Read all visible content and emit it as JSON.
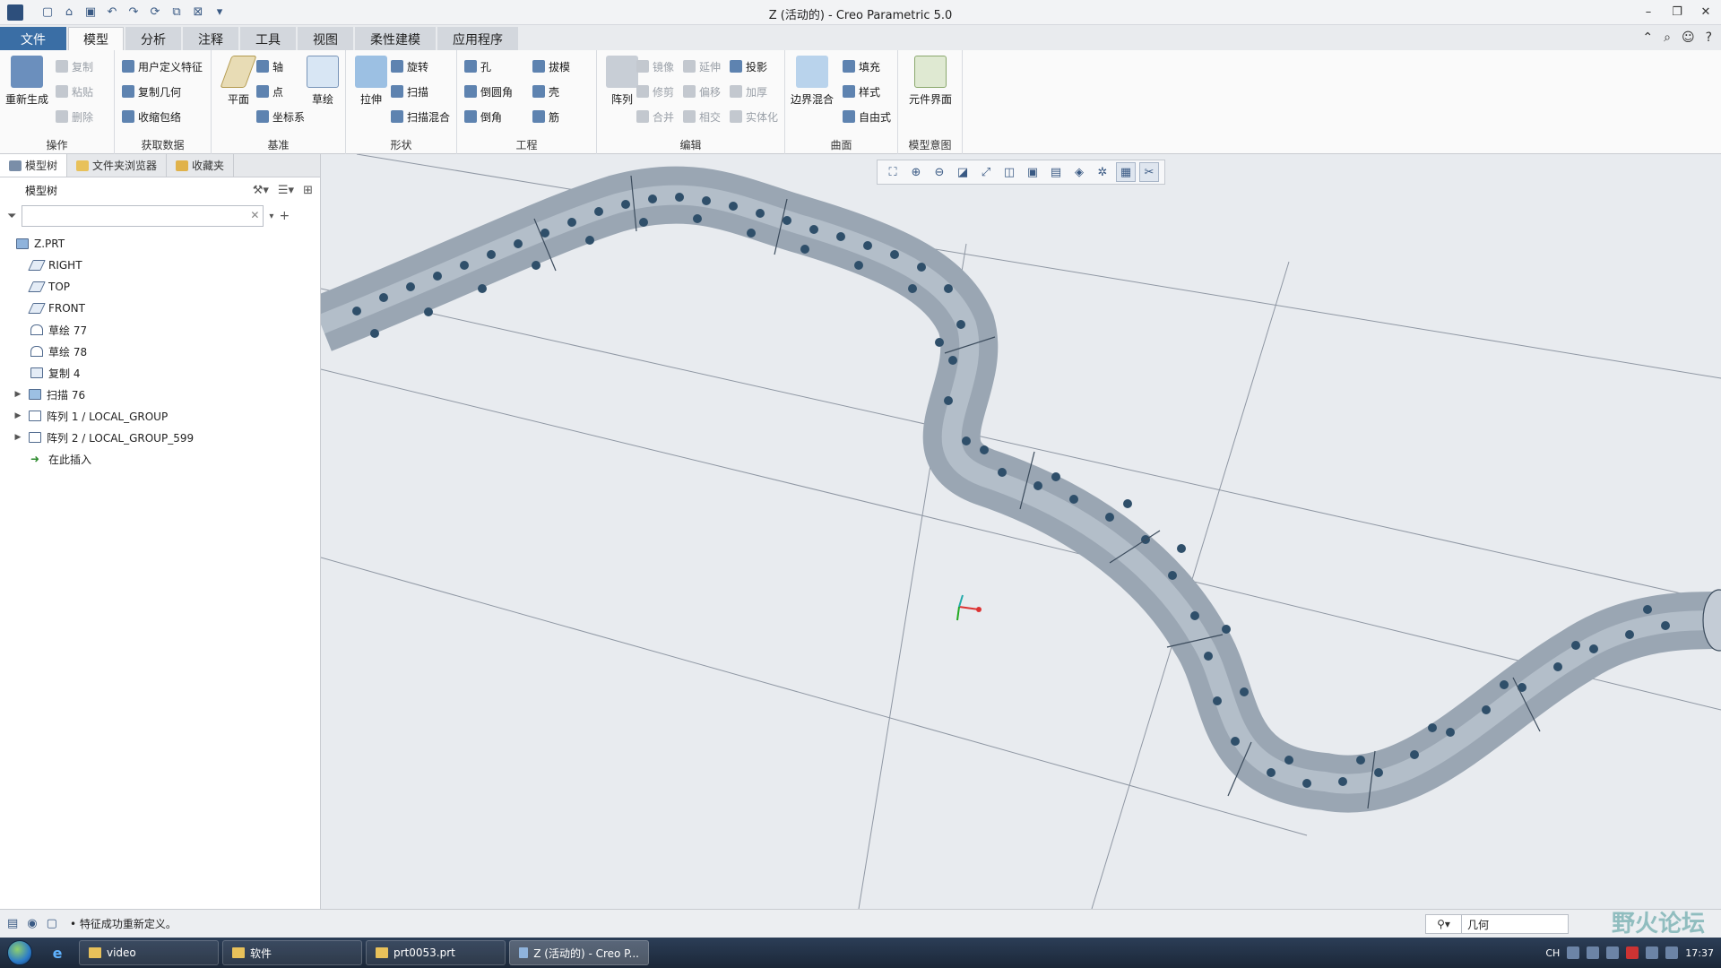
{
  "window": {
    "title": "Z (活动的) - Creo Parametric 5.0"
  },
  "ribbon_tabs": [
    {
      "label": "文件"
    },
    {
      "label": "模型"
    },
    {
      "label": "分析"
    },
    {
      "label": "注释"
    },
    {
      "label": "工具"
    },
    {
      "label": "视图"
    },
    {
      "label": "柔性建模"
    },
    {
      "label": "应用程序"
    }
  ],
  "ribbon": {
    "operations": {
      "regenerate": "重新生成",
      "copy": "复制",
      "paste": "粘贴",
      "delete": "删除",
      "group_label": "操作"
    },
    "get_data": {
      "udf": "用户定义特征",
      "copy_geometry": "复制几何",
      "shrinkwrap": "收缩包络",
      "group_label": "获取数据"
    },
    "datum": {
      "plane": "平面",
      "axis": "轴",
      "point": "点",
      "csys": "坐标系",
      "sketch": "草绘",
      "group_label": "基准"
    },
    "shapes": {
      "extrude": "拉伸",
      "revolve": "旋转",
      "sweep": "扫描",
      "swept_blend": "扫描混合",
      "group_label": "形状"
    },
    "engineering": {
      "hole": "孔",
      "draft": "拔模",
      "round": "倒圆角",
      "shell": "壳",
      "chamfer": "倒角",
      "rib": "筋",
      "group_label": "工程"
    },
    "editing": {
      "pattern": "阵列",
      "mirror": "镜像",
      "extend": "延伸",
      "project": "投影",
      "trim": "修剪",
      "offset": "偏移",
      "thicken": "加厚",
      "merge": "合并",
      "intersect": "相交",
      "solidify": "实体化",
      "group_label": "编辑"
    },
    "surfaces": {
      "boundary_blend": "边界混合",
      "fill": "填充",
      "style": "样式",
      "freestyle": "自由式",
      "group_label": "曲面"
    },
    "model_intent": {
      "component_interface": "元件界面",
      "group_label": "模型意图"
    }
  },
  "left_panel": {
    "tabs": [
      {
        "label": "模型树"
      },
      {
        "label": "文件夹浏览器"
      },
      {
        "label": "收藏夹"
      }
    ],
    "tree_header": "模型树",
    "search_placeholder": "",
    "tree_items": [
      {
        "label": "Z.PRT"
      },
      {
        "label": "RIGHT"
      },
      {
        "label": "TOP"
      },
      {
        "label": "FRONT"
      },
      {
        "label": "草绘 77"
      },
      {
        "label": "草绘 78"
      },
      {
        "label": "复制 4"
      },
      {
        "label": "扫描 76"
      },
      {
        "label": "阵列 1 / LOCAL_GROUP"
      },
      {
        "label": "阵列 2 / LOCAL_GROUP_599"
      },
      {
        "label": "在此插入"
      }
    ]
  },
  "status": {
    "message": "• 特征成功重新定义。",
    "filter_value": "几何"
  },
  "taskbar": {
    "items": [
      {
        "label": "video"
      },
      {
        "label": "软件"
      },
      {
        "label": "prt0053.prt"
      },
      {
        "label": "Z (活动的) - Creo P..."
      }
    ],
    "tray_lang": "CH",
    "clock": "17:37"
  },
  "watermark": "野火论坛",
  "colors": {
    "file_tab": "#3a6ea5",
    "pipe_fill": "#9aa6b3",
    "hole_fill": "#2f4f6a",
    "axis_lines": "#c8d3e0"
  }
}
